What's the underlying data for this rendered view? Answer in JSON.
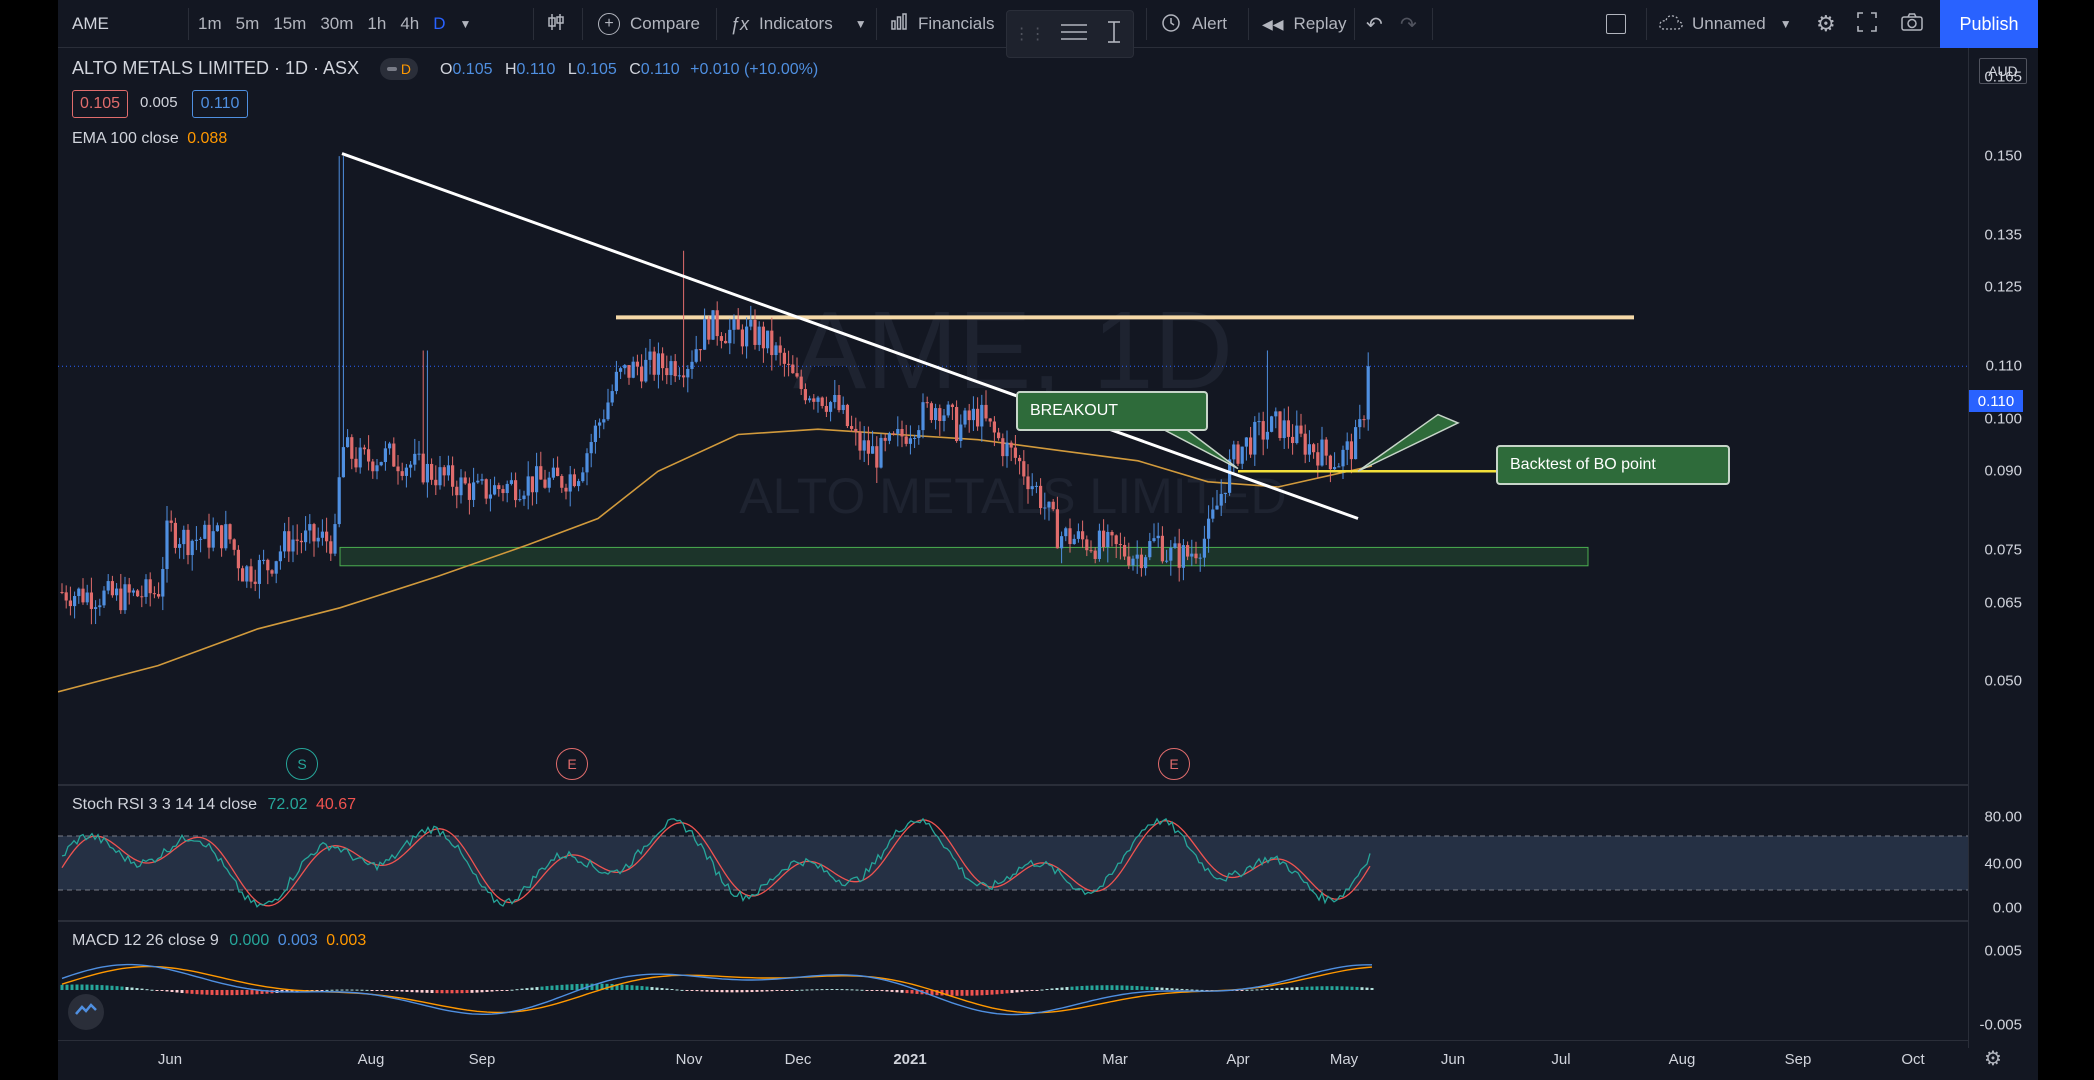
{
  "toolbar": {
    "symbol": "AME",
    "intervals": [
      "1m",
      "5m",
      "15m",
      "30m",
      "1h",
      "4h",
      "D"
    ],
    "compare": "Compare",
    "indicators": "Indicators",
    "financials": "Financials",
    "alert": "Alert",
    "replay": "Replay",
    "layout_name": "Unnamed",
    "publish": "Publish"
  },
  "legend": {
    "title": "ALTO METALS LIMITED · 1D · ASX",
    "interval_badge": "D",
    "o_label": "O",
    "o": "0.105",
    "h_label": "H",
    "h": "0.110",
    "l_label": "L",
    "l": "0.105",
    "c_label": "C",
    "c": "0.110",
    "change": "+0.010 (+10.00%)",
    "bid": "0.105",
    "spread": "0.005",
    "ask": "0.110",
    "ema_label": "EMA 100 close",
    "ema_value": "0.088"
  },
  "price_axis": {
    "currency": "AUD",
    "ticks": [
      "0.165",
      "0.150",
      "0.135",
      "0.125",
      "0.110",
      "0.100",
      "0.090",
      "0.075",
      "0.065",
      "0.050"
    ],
    "last_price": "0.110"
  },
  "watermark": {
    "symbol": "AME, 1D",
    "name": "ALTO METALS LIMITED"
  },
  "annotations": {
    "breakout": "BREAKOUT",
    "backtest": "Backtest of BO point"
  },
  "events": [
    "S",
    "E",
    "E"
  ],
  "stoch": {
    "label": "Stoch RSI 3 3 14 14 close",
    "k": "72.02",
    "d": "40.67",
    "ticks": [
      "80.00",
      "40.00",
      "0.00"
    ]
  },
  "macd": {
    "label": "MACD 12 26 close 9",
    "hist": "0.000",
    "macd": "0.003",
    "signal": "0.003",
    "ticks": [
      "0.005",
      "-0.005"
    ]
  },
  "time_axis": [
    "Jun",
    "Aug",
    "Sep",
    "Nov",
    "Dec",
    "2021",
    "Mar",
    "Apr",
    "May",
    "Jun",
    "Jul",
    "Aug",
    "Sep",
    "Oct"
  ],
  "colors": {
    "up": "#4f8fe0",
    "down": "#e06c6c",
    "ema": "#d19a3c",
    "trendline": "#ffffff",
    "resistance": "#f5d9a8",
    "support_zone": "#2e6b3a",
    "backtest_line": "#f3e03a",
    "accent": "#2962ff"
  },
  "chart_data": {
    "type": "candlestick",
    "title": "ALTO METALS LIMITED · 1D · ASX",
    "approx_close_path": [
      {
        "x": "May",
        "y": 0.067
      },
      {
        "x": "Jun",
        "y": 0.078
      },
      {
        "x": "Jul",
        "y": 0.075
      },
      {
        "x": "late Jul spike high",
        "y": 0.15
      },
      {
        "x": "Aug",
        "y": 0.092
      },
      {
        "x": "Sep",
        "y": 0.088
      },
      {
        "x": "Oct",
        "y": 0.115
      },
      {
        "x": "Nov",
        "y": 0.12
      },
      {
        "x": "Dec",
        "y": 0.1
      },
      {
        "x": "2021",
        "y": 0.098
      },
      {
        "x": "Feb",
        "y": 0.078
      },
      {
        "x": "Mar",
        "y": 0.074
      },
      {
        "x": "Apr",
        "y": 0.095
      },
      {
        "x": "May",
        "y": 0.11
      }
    ],
    "levels": {
      "resistance": 0.119,
      "backtest": 0.09,
      "support_zone": [
        0.072,
        0.075
      ]
    },
    "ylim": [
      0.04,
      0.17
    ]
  }
}
